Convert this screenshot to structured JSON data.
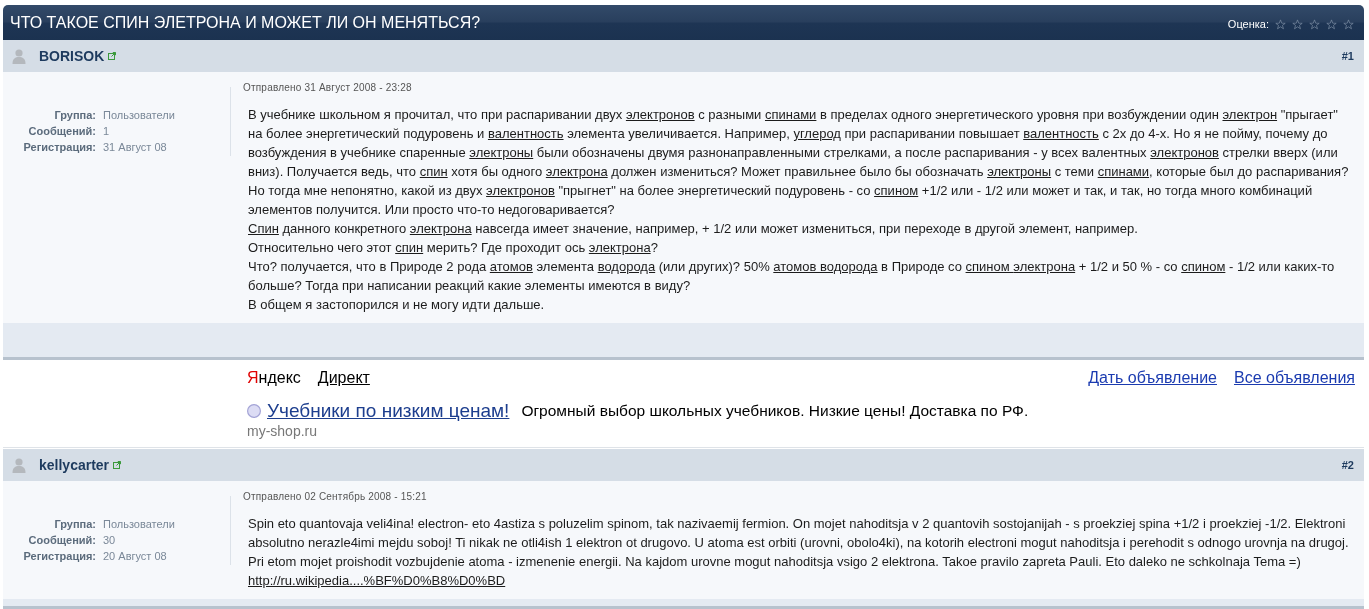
{
  "topic": {
    "title": "ЧТО ТАКОЕ СПИН ЭЛЕТРОНА И МОЖЕТ ЛИ ОН МЕНЯТЬСЯ?",
    "rating_label": "Оценка:",
    "stars": 0
  },
  "thread": [
    {
      "kind": "post",
      "author": "BORISOK",
      "number": "#1",
      "posted": "Отправлено 31 Август 2008 - 23:28",
      "info": [
        {
          "label": "Группа:",
          "value": "Пользователи"
        },
        {
          "label": "Сообщений:",
          "value": "1"
        },
        {
          "label": "Регистрация:",
          "value": "31 Август 08"
        }
      ],
      "paragraphs": [
        [
          {
            "kind": "text",
            "text": "В учебнике школьном я прочитал, что при распаривании двух "
          },
          {
            "kind": "link",
            "text": "электронов"
          },
          {
            "kind": "text",
            "text": " с разными "
          },
          {
            "kind": "link",
            "text": "спинами"
          },
          {
            "kind": "text",
            "text": " в пределах одного энергетического уровня при возбуждении один "
          },
          {
            "kind": "link",
            "text": "электрон"
          },
          {
            "kind": "text",
            "text": " \"прыгает\" на более энергетический подуровень и "
          },
          {
            "kind": "link",
            "text": "валентность"
          },
          {
            "kind": "text",
            "text": " элемента увеличивается. Например, "
          },
          {
            "kind": "link",
            "text": "углерод"
          },
          {
            "kind": "text",
            "text": " при распаривании повышает "
          },
          {
            "kind": "link",
            "text": "валентность"
          },
          {
            "kind": "text",
            "text": " с 2х до 4-х. Но я не пойму, почему до возбуждения в учебнике спаренные "
          },
          {
            "kind": "link",
            "text": "электроны"
          },
          {
            "kind": "text",
            "text": " были обозначены двумя разнонаправленными стрелками, а после распаривания - у всех валентных "
          },
          {
            "kind": "link",
            "text": "электронов"
          },
          {
            "kind": "text",
            "text": " стрелки вверх (или вниз). Получается ведь, что "
          },
          {
            "kind": "link",
            "text": "спин"
          },
          {
            "kind": "text",
            "text": " хотя бы одного "
          },
          {
            "kind": "link",
            "text": "электрона"
          },
          {
            "kind": "text",
            "text": " должен измениться? Может правильнее было бы обозначать "
          },
          {
            "kind": "link",
            "text": "электроны"
          },
          {
            "kind": "text",
            "text": " с теми "
          },
          {
            "kind": "link",
            "text": "спинами"
          },
          {
            "kind": "text",
            "text": ", которые был до распаривания? Но тогда мне непонятно, какой из двух "
          },
          {
            "kind": "link",
            "text": "электронов"
          },
          {
            "kind": "text",
            "text": " \"прыгнет\" на более энергетический подуровень - со "
          },
          {
            "kind": "link",
            "text": "спином"
          },
          {
            "kind": "text",
            "text": " +1/2 или - 1/2 или может и так, и так, но тогда много комбинаций элементов получится. Или просто что-то недоговаривается?"
          }
        ],
        [
          {
            "kind": "link",
            "text": "Спин"
          },
          {
            "kind": "text",
            "text": " данного конкретного "
          },
          {
            "kind": "link",
            "text": "электрона"
          },
          {
            "kind": "text",
            "text": " навсегда имеет значение, например, + 1/2 или может измениться, при переходе в другой элемент, например."
          }
        ],
        [
          {
            "kind": "text",
            "text": "Относительно чего этот "
          },
          {
            "kind": "link",
            "text": "спин"
          },
          {
            "kind": "text",
            "text": " мерить? Где проходит ось "
          },
          {
            "kind": "link",
            "text": "электрона"
          },
          {
            "kind": "text",
            "text": "?"
          }
        ],
        [
          {
            "kind": "text",
            "text": "Что? получается, что в Природе 2 рода "
          },
          {
            "kind": "link",
            "text": "атомов"
          },
          {
            "kind": "text",
            "text": " элемента "
          },
          {
            "kind": "link",
            "text": "водорода"
          },
          {
            "kind": "text",
            "text": " (или других)? 50% "
          },
          {
            "kind": "link",
            "text": "атомов "
          },
          {
            "kind": "link",
            "text": "водорода"
          },
          {
            "kind": "text",
            "text": " в Природе со "
          },
          {
            "kind": "link",
            "text": "спином "
          },
          {
            "kind": "link",
            "text": "электрона"
          },
          {
            "kind": "text",
            "text": " + 1/2 и 50 % - со "
          },
          {
            "kind": "link",
            "text": "спином"
          },
          {
            "kind": "text",
            "text": " - 1/2 или каких-то больше? Тогда при написании реакций какие элементы имеются в виду?"
          }
        ],
        [
          {
            "kind": "text",
            "text": "В общем я застопорился и не могу идти дальше."
          }
        ]
      ]
    },
    {
      "kind": "ad",
      "network": "Яндекс",
      "service": "Директ",
      "actions": [
        "Дать объявление",
        "Все объявления"
      ],
      "items": [
        {
          "title": "Учебники по низким ценам!",
          "text": "Огромный выбор школьных учебников. Низкие цены! Доставка по РФ.",
          "domain": "my-shop.ru"
        }
      ]
    },
    {
      "kind": "post",
      "author": "kellycarter",
      "number": "#2",
      "posted": "Отправлено 02 Сентябрь 2008 - 15:21",
      "info": [
        {
          "label": "Группа:",
          "value": "Пользователи"
        },
        {
          "label": "Сообщений:",
          "value": "30"
        },
        {
          "label": "Регистрация:",
          "value": "20 Август 08"
        }
      ],
      "paragraphs": [
        [
          {
            "kind": "text",
            "text": "Spin eto quantovaja veli4ina! electron- eto 4astiza s poluzelim spinom, tak nazivaemij fermion. On mojet nahoditsja v 2 quantovih sostojanijah - s proekziej spina +1/2 i proekziej -1/2. Elektroni absolutno nerazle4imi mejdu soboj! Ti nikak ne otli4ish 1 elektron ot drugovo. U atoma est orbiti (urovni, obolo4ki), na kotorih electroni mogut nahoditsja i perehodit s odnogo urovnja na drugoj. Pri etom mojet proishodit vozbujdenie atoma - izmenenie energii. Na kajdom urovne mogut nahoditsja vsigo 2 elektrona. Takoe pravilo zapreta Pauli. Eto daleko ne schkolnaja Tema =) "
          },
          {
            "kind": "link",
            "text": "http://ru.wikipedia....%BF%D0%B8%D0%BD"
          }
        ]
      ]
    }
  ]
}
